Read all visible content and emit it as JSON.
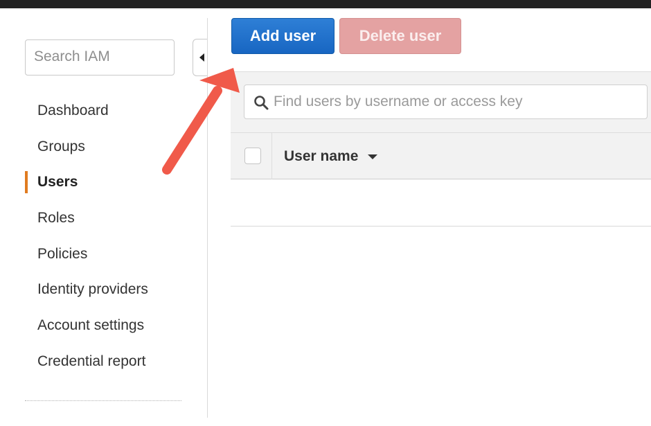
{
  "sidebar": {
    "search_placeholder": "Search IAM",
    "items": [
      {
        "label": "Dashboard"
      },
      {
        "label": "Groups"
      },
      {
        "label": "Users",
        "active": true
      },
      {
        "label": "Roles"
      },
      {
        "label": "Policies"
      },
      {
        "label": "Identity providers"
      },
      {
        "label": "Account settings"
      },
      {
        "label": "Credential report"
      }
    ]
  },
  "toolbar": {
    "add_user_label": "Add user",
    "delete_user_label": "Delete user"
  },
  "users_table": {
    "search_placeholder": "Find users by username or access key",
    "columns": [
      {
        "label": "User name",
        "sort": "descending"
      }
    ]
  },
  "annotation": {
    "color": "#f05a4a",
    "icon": "arrow-pointer-icon"
  },
  "colors": {
    "primary_button": "#1f6fcb",
    "disabled_delete_button": "#e4a2a2",
    "active_nav_marker": "#e07b20"
  }
}
